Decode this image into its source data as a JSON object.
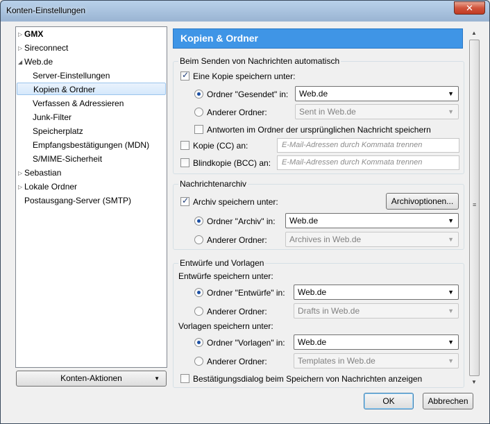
{
  "window": {
    "title": "Konten-Einstellungen",
    "close": "✕"
  },
  "tree": {
    "items": [
      {
        "label": "GMX",
        "bold": true,
        "expander": "▷"
      },
      {
        "label": "Sireconnect",
        "expander": "▷"
      },
      {
        "label": "Web.de",
        "expander": "◢"
      },
      {
        "label": "Server-Einstellungen"
      },
      {
        "label": "Kopien & Ordner",
        "selected": true
      },
      {
        "label": "Verfassen & Adressieren"
      },
      {
        "label": "Junk-Filter"
      },
      {
        "label": "Speicherplatz"
      },
      {
        "label": "Empfangsbestätigungen (MDN)"
      },
      {
        "label": "S/MIME-Sicherheit"
      },
      {
        "label": "Sebastian",
        "expander": "▷"
      },
      {
        "label": "Lokale Ordner",
        "expander": "▷"
      },
      {
        "label": "Postausgang-Server (SMTP)"
      }
    ],
    "actions_button": "Konten-Aktionen",
    "actions_arrow": "▼"
  },
  "pane": {
    "title": "Kopien & Ordner",
    "sending": {
      "group_title": "Beim Senden von Nachrichten automatisch",
      "save_copy_label": "Eine Kopie speichern unter:",
      "folder_sent_label": "Ordner \"Gesendet\" in:",
      "folder_sent_value": "Web.de",
      "other_folder_label": "Anderer Ordner:",
      "other_folder_value": "Sent in Web.de",
      "reply_folder_label": "Antworten im Ordner der ursprünglichen Nachricht speichern",
      "cc_label": "Kopie (CC) an:",
      "cc_placeholder": "E-Mail-Adressen durch Kommata trennen",
      "bcc_label": "Blindkopie (BCC) an:",
      "bcc_placeholder": "E-Mail-Adressen durch Kommata trennen"
    },
    "archive": {
      "group_title": "Nachrichtenarchiv",
      "save_archive_label": "Archiv speichern unter:",
      "options_button": "Archivoptionen...",
      "folder_archive_label": "Ordner \"Archiv\" in:",
      "folder_archive_value": "Web.de",
      "other_folder_label": "Anderer Ordner:",
      "other_folder_value": "Archives in Web.de"
    },
    "drafts": {
      "group_title": "Entwürfe und Vorlagen",
      "drafts_heading": "Entwürfe speichern unter:",
      "folder_drafts_label": "Ordner \"Entwürfe\" in:",
      "folder_drafts_value": "Web.de",
      "drafts_other_label": "Anderer Ordner:",
      "drafts_other_value": "Drafts in Web.de",
      "templates_heading": "Vorlagen speichern unter:",
      "folder_templates_label": "Ordner \"Vorlagen\" in:",
      "folder_templates_value": "Web.de",
      "templates_other_label": "Anderer Ordner:",
      "templates_other_value": "Templates in Web.de",
      "confirm_label": "Bestätigungsdialog beim Speichern von Nachrichten anzeigen"
    }
  },
  "dialog": {
    "ok": "OK",
    "cancel": "Abbrechen"
  },
  "icons": {
    "dropdown": "▼",
    "scroll_up": "▲",
    "scroll_down": "▼",
    "grip": "≡"
  }
}
